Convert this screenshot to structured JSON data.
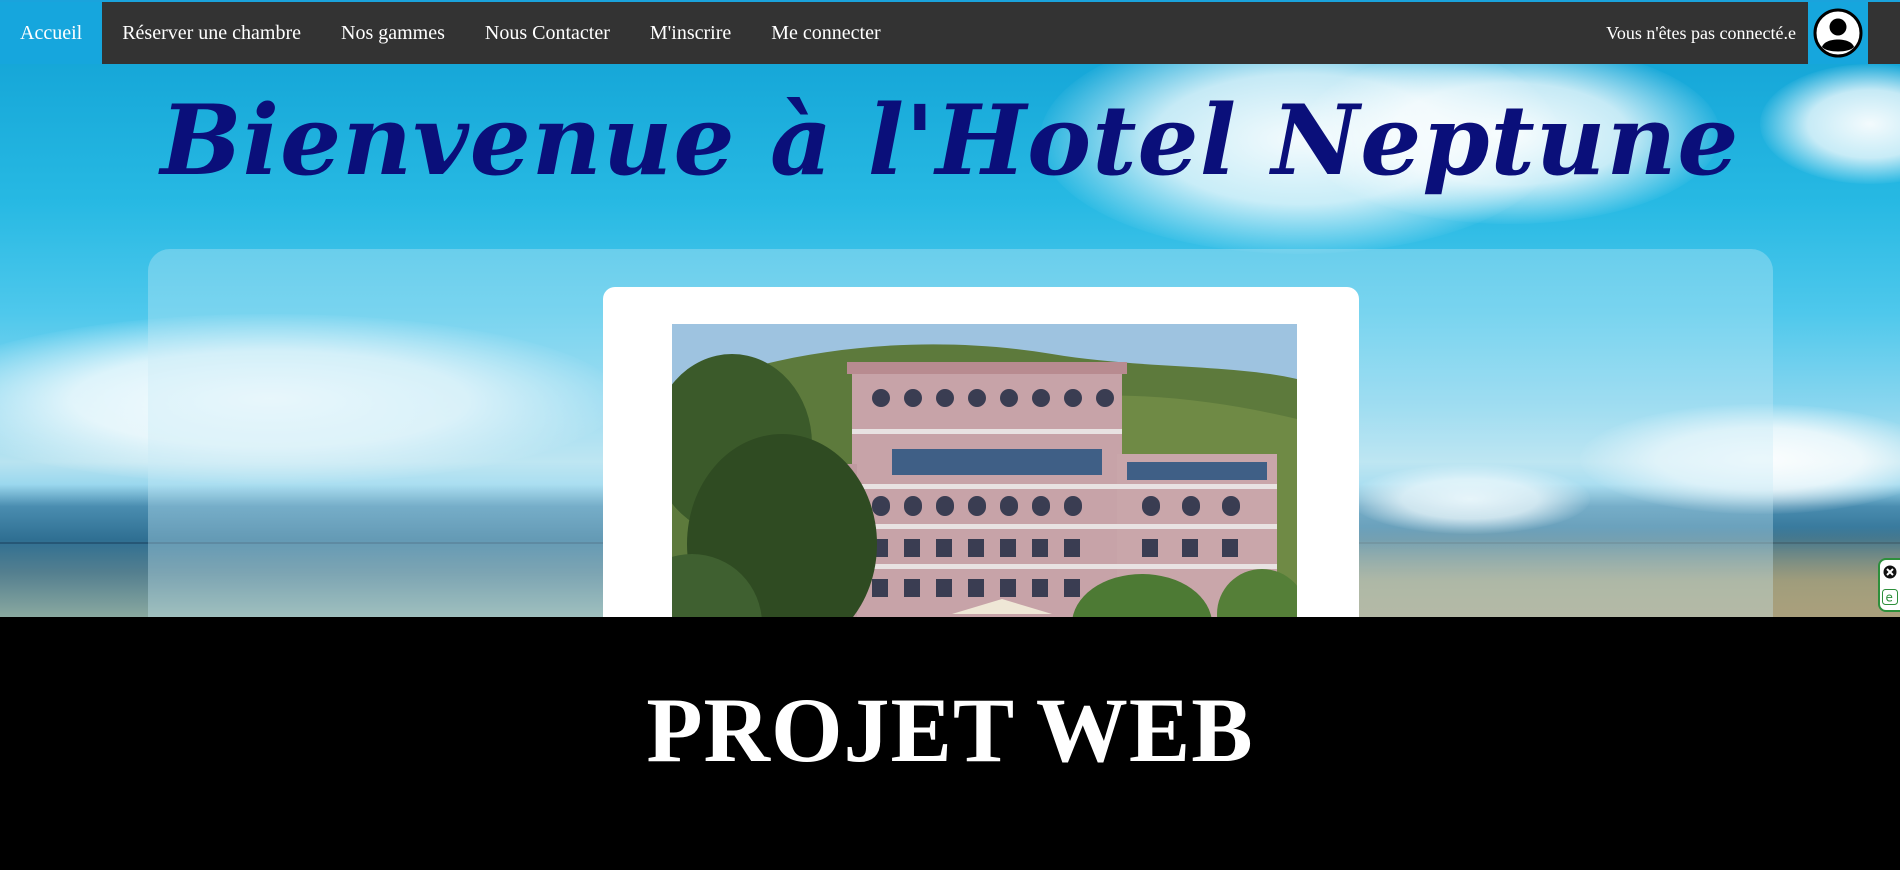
{
  "nav": {
    "items": [
      {
        "label": "Accueil",
        "active": true
      },
      {
        "label": "Réserver une chambre",
        "active": false
      },
      {
        "label": "Nos gammes",
        "active": false
      },
      {
        "label": "Nous Contacter",
        "active": false
      },
      {
        "label": "M'inscrire",
        "active": false
      },
      {
        "label": "Me connecter",
        "active": false
      }
    ],
    "status_text": "Vous n'êtes pas connecté.e",
    "avatar_icon": "user-avatar-icon"
  },
  "hero": {
    "title": "Bienvenue à l'Hotel Neptune",
    "photo_subject": "hotel-building-photo"
  },
  "footer": {
    "title": "PROJET WEB"
  },
  "colors": {
    "nav_bg": "#333333",
    "accent": "#16a6dd",
    "title_color": "#0a0f7a",
    "footer_bg": "#000000"
  }
}
